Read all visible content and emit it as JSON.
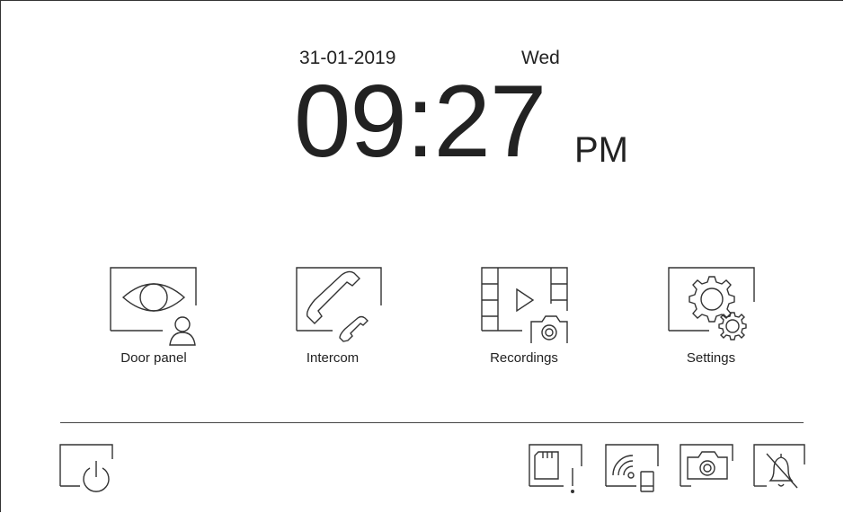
{
  "clock": {
    "date": "31-01-2019",
    "weekday": "Wed",
    "time": "09:27",
    "ampm": "PM"
  },
  "apps": [
    {
      "label": "Door panel",
      "icon": "eye-person-icon"
    },
    {
      "label": "Intercom",
      "icon": "handset-icon"
    },
    {
      "label": "Recordings",
      "icon": "film-camera-icon"
    },
    {
      "label": "Settings",
      "icon": "gears-icon"
    }
  ],
  "tray": {
    "power": {
      "icon": "power-icon"
    },
    "sd_card": {
      "icon": "sd-card-warning-icon"
    },
    "wifi": {
      "icon": "wifi-phone-icon"
    },
    "camera": {
      "icon": "camera-icon"
    },
    "mute": {
      "icon": "bell-muted-icon"
    }
  },
  "colors": {
    "stroke": "#333333",
    "background": "#ffffff"
  }
}
